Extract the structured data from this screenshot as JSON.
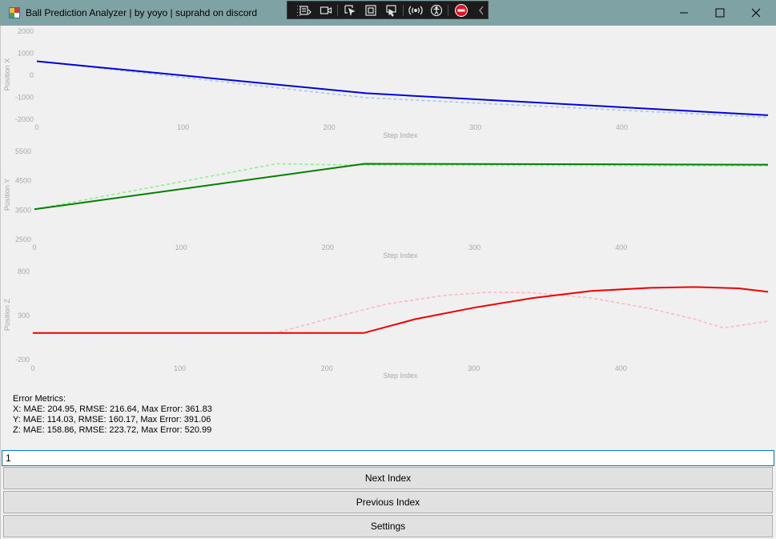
{
  "window": {
    "title": "Ball Prediction Analyzer | by yoyo | suprahd on discord",
    "controls": [
      "minimize-icon",
      "maximize-icon",
      "close-icon"
    ]
  },
  "toolbar_icons": [
    "capture-mode-icon",
    "record-video-icon",
    "pointer-select-icon",
    "select-element-icon",
    "select-region-icon",
    "live-inspect-icon",
    "accessibility-icon",
    "stop-icon",
    "collapse-chevron-icon"
  ],
  "colors": {
    "titlebar": "#7fa3a4",
    "x_actual": "#0000dd",
    "x_pred": "#a8c8f0",
    "y_actual": "#008000",
    "y_pred": "#90ee90",
    "z_actual": "#ee0000",
    "z_pred": "#ffb6c1"
  },
  "chart_data": [
    {
      "type": "line",
      "ylabel": "Position X",
      "xlabel": "Step Index",
      "xlim": [
        0,
        500
      ],
      "ylim": [
        -2000,
        2000
      ],
      "x_ticks": [
        "0",
        "100",
        "200",
        "300",
        "400"
      ],
      "y_ticks": [
        "2000",
        "1000",
        "0",
        "-1000",
        "-2000"
      ],
      "series": [
        {
          "role": "actual",
          "style": "solid",
          "x": [
            0,
            225,
            500
          ],
          "y": [
            600,
            -850,
            -1850
          ]
        },
        {
          "role": "predicted",
          "style": "dashed",
          "x": [
            0,
            225,
            500
          ],
          "y": [
            600,
            -1050,
            -1950
          ]
        }
      ]
    },
    {
      "type": "line",
      "ylabel": "Position Y",
      "xlabel": "Step Index",
      "xlim": [
        0,
        500
      ],
      "ylim": [
        2500,
        5500
      ],
      "x_ticks": [
        "0",
        "100",
        "200",
        "300",
        "400"
      ],
      "y_ticks": [
        "5500",
        "4500",
        "3500",
        "2500"
      ],
      "series": [
        {
          "role": "actual",
          "style": "solid",
          "x": [
            0,
            225,
            500
          ],
          "y": [
            3500,
            5050,
            5020
          ]
        },
        {
          "role": "predicted",
          "style": "dashed",
          "x": [
            0,
            165,
            225,
            500
          ],
          "y": [
            3500,
            5050,
            5000,
            4980
          ]
        }
      ]
    },
    {
      "type": "line",
      "ylabel": "Position Z",
      "xlabel": "Step Index",
      "xlim": [
        0,
        500
      ],
      "ylim": [
        -200,
        800
      ],
      "x_ticks": [
        "0",
        "100",
        "200",
        "300",
        "400"
      ],
      "y_ticks": [
        "800",
        "300",
        "-200"
      ],
      "series": [
        {
          "role": "actual",
          "style": "solid",
          "x": [
            0,
            225,
            260,
            300,
            340,
            380,
            420,
            450,
            480,
            500
          ],
          "y": [
            93,
            93,
            250,
            380,
            490,
            570,
            605,
            615,
            600,
            560
          ]
        },
        {
          "role": "predicted",
          "style": "dashed",
          "x": [
            0,
            165,
            200,
            240,
            280,
            310,
            340,
            380,
            420,
            450,
            470,
            500
          ],
          "y": [
            93,
            93,
            250,
            420,
            520,
            555,
            550,
            490,
            370,
            250,
            150,
            228
          ]
        }
      ]
    }
  ],
  "metrics": {
    "title": "Error Metrics:",
    "x": "X: MAE: 204.95, RMSE: 216.64, Max Error: 361.83",
    "y": "Y: MAE: 114.03, RMSE: 160.17, Max Error: 391.06",
    "z": "Z: MAE: 158.86, RMSE: 223.72, Max Error: 520.99"
  },
  "index_input": {
    "value": "1"
  },
  "buttons": {
    "next": "Next Index",
    "previous": "Previous Index",
    "settings": "Settings"
  }
}
